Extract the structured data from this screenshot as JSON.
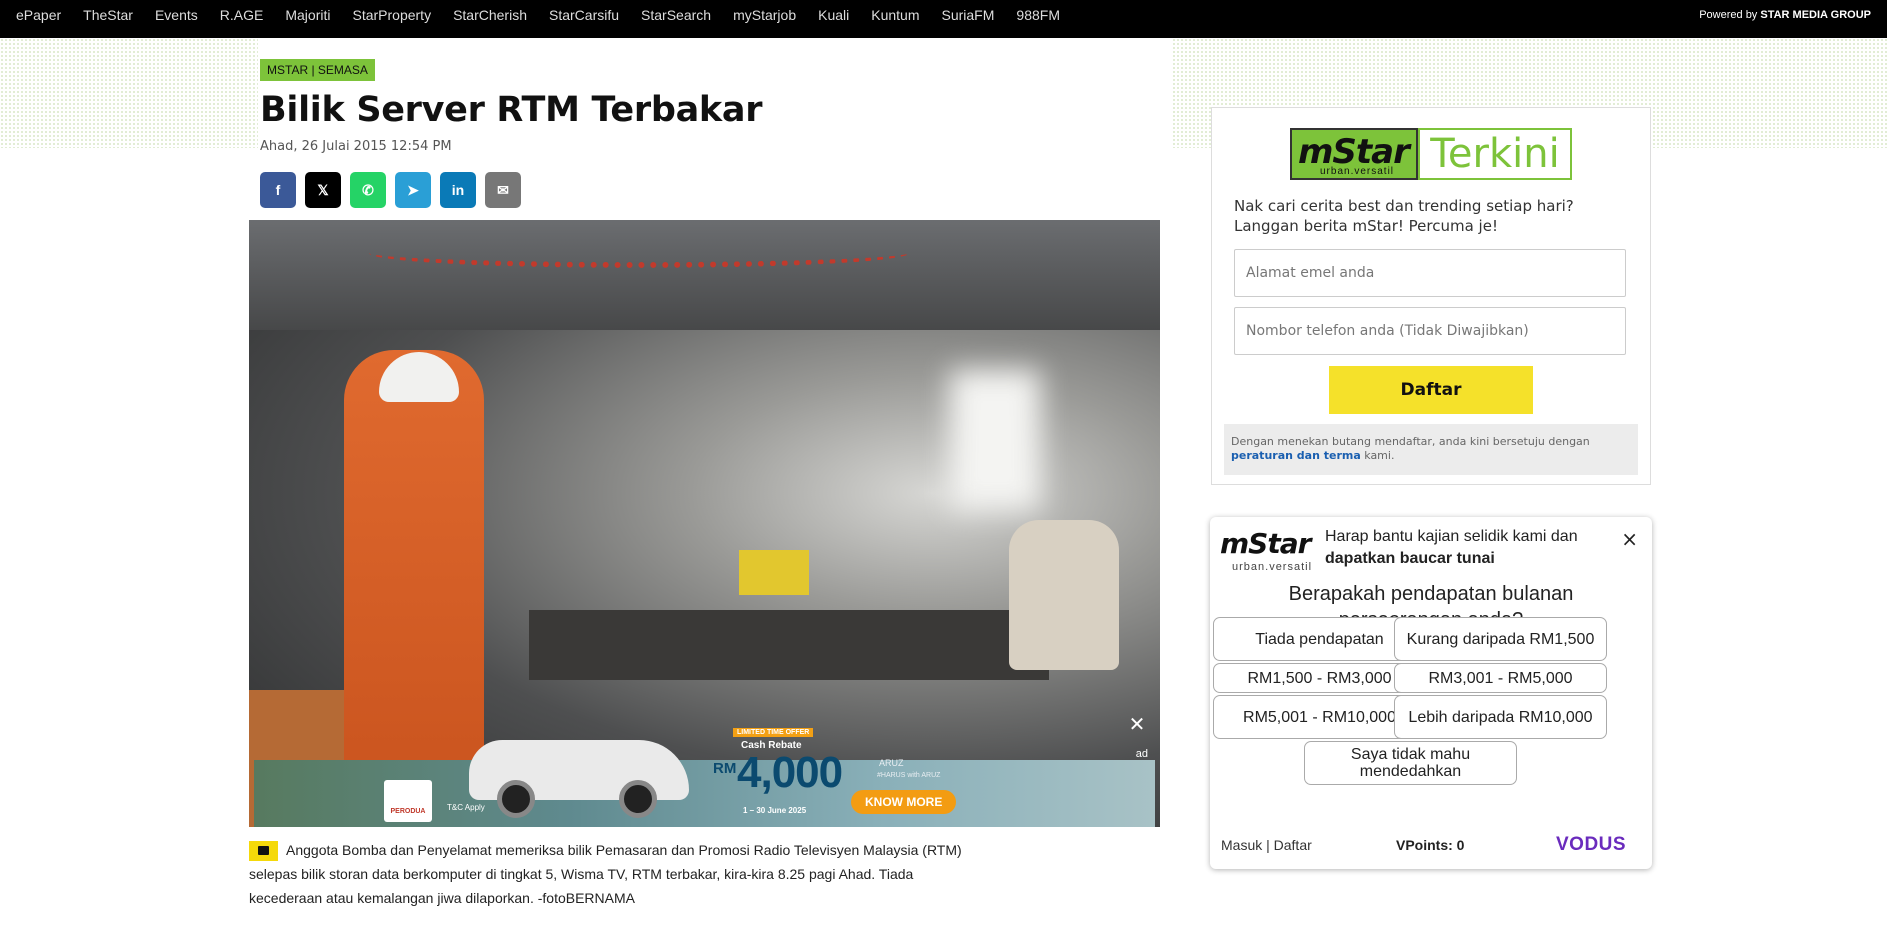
{
  "topnav": {
    "links": [
      "ePaper",
      "TheStar",
      "Events",
      "R.AGE",
      "Majoriti",
      "StarProperty",
      "StarCherish",
      "StarCarsifu",
      "StarSearch",
      "myStarjob",
      "Kuali",
      "Kuntum",
      "SuriaFM",
      "988FM"
    ],
    "powered_prefix": "Powered by",
    "powered_brand": "STAR MEDIA GROUP"
  },
  "article": {
    "tag": "MSTAR | SEMASA",
    "headline": "Bilik Server RTM Terbakar",
    "date": "Ahad, 26 Julai 2015 12:54 PM",
    "share": [
      {
        "name": "facebook",
        "glyph": "f"
      },
      {
        "name": "x",
        "glyph": "𝕏"
      },
      {
        "name": "whatsapp",
        "glyph": "✆"
      },
      {
        "name": "telegram",
        "glyph": "➤"
      },
      {
        "name": "linkedin",
        "glyph": "in"
      },
      {
        "name": "email",
        "glyph": "✉"
      }
    ],
    "caption": "Anggota Bomba dan Penyelamat memeriksa bilik Pemasaran dan Promosi Radio Televisyen Malaysia (RTM) selepas bilik storan data berkomputer di tingkat 5, Wisma TV, RTM terbakar, kira-kira 8.25 pagi Ahad. Tiada kecederaan atau kemalangan jiwa dilaporkan. -fotoBERNAMA"
  },
  "ad": {
    "close": "✕",
    "label": "ad",
    "brand": "PERODUA",
    "tc": "T&C Apply",
    "offer": "LIMITED TIME OFFER",
    "cash_rebate": "Cash Rebate",
    "currency": "RM",
    "amount": "4,000",
    "dates": "1 – 30 June 2025",
    "cta": "KNOW MORE",
    "model": "ARUZ",
    "tagline": "#HARUS with ARUZ"
  },
  "newsletter": {
    "logo_m": "mStar",
    "logo_sub": "urban.versatil",
    "logo_right": "Terkini",
    "intro": "Nak cari cerita best dan trending setiap hari? Langgan berita mStar! Percuma je!",
    "email_placeholder": "Alamat emel anda",
    "phone_placeholder": "Nombor telefon anda (Tidak Diwajibkan)",
    "submit": "Daftar",
    "terms_pre": "Dengan menekan butang mendaftar, anda kini bersetuju dengan",
    "terms_link": "peraturan dan terma",
    "terms_post": "kami."
  },
  "survey": {
    "logo_m": "mStar",
    "logo_sub": "urban.versatil",
    "help_pre": "Harap bantu kajian selidik kami dan",
    "help_bold": "dapatkan baucar tunai",
    "close": "×",
    "question": "Berapakah pendapatan bulanan perseorangan anda?",
    "options": [
      "Tiada pendapatan",
      "Kurang daripada RM1,500",
      "RM1,500 - RM3,000",
      "RM3,001 - RM5,000",
      "RM5,001 - RM10,000",
      "Lebih daripada RM10,000",
      "Saya tidak mahu mendedahkan"
    ],
    "footer_auth": "Masuk | Daftar",
    "vpoints": "VPoints: 0",
    "vodus": "VODUS"
  }
}
